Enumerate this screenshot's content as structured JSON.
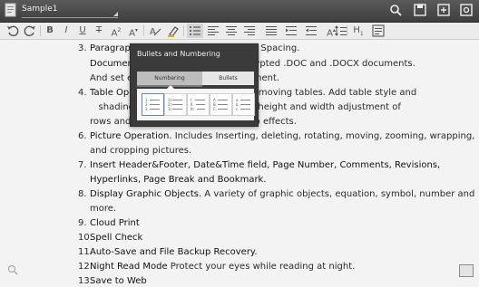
{
  "titlebar": {
    "doc_title": "Sample1",
    "icons": [
      "search-icon",
      "save-icon",
      "new-document-icon",
      "settings-icon"
    ]
  },
  "toolbar": {
    "tools": [
      "undo-icon",
      "redo-icon",
      "bold-icon",
      "italic-icon",
      "underline-icon",
      "strikethrough-icon",
      "font-size-icon",
      "font-color-icon",
      "clear-format-icon",
      "highlight-icon",
      "bullet-list-icon",
      "align-left-icon",
      "align-center-icon",
      "align-right-icon",
      "justify-icon",
      "indent-icon",
      "outdent-icon",
      "grow-font-icon",
      "line-spacing-icon",
      "heading-icon",
      "insert-icon"
    ],
    "labels": {
      "bold": "B",
      "italic": "I",
      "underline": "U",
      "strike": "T",
      "fontsize": "A",
      "fontcolor": "A",
      "heading": "H"
    }
  },
  "document": {
    "items": [
      {
        "num": "3.",
        "bold": "Paragrap",
        "rest": "                                    t and Spacing."
      },
      {
        "num": "",
        "bold": "Documen",
        "rest": "                                     ncrypted .DOC and .DOCX documents."
      },
      {
        "num": "",
        "bold": "",
        "rest": "And set e                                    ocument."
      },
      {
        "num": "4.",
        "bold": "Table Ope",
        "rest": "                                    and moving tables. Add table style and"
      },
      {
        "num": "",
        "bold": "",
        "rest": "   shading                                  ition, height and width adjustment of"
      },
      {
        "num": "",
        "bold": "",
        "rest": "rows and                                     wrap effects."
      },
      {
        "num": "6.",
        "bold": "Picture Operation.",
        "rest": " Includes Inserting, deleting, rotating, moving, zooming, wrapping,"
      },
      {
        "num": "",
        "bold": "",
        "rest": "and cropping pictures."
      },
      {
        "num": "7.",
        "bold": "Insert Header&Footer, Date&Time field, Page Number, Comments, Revisions,",
        "rest": ""
      },
      {
        "num": "",
        "bold": "Hyperlinks, Page Break and Bookmark.",
        "rest": ""
      },
      {
        "num": "8.",
        "bold": "Display Graphic Objects.",
        "rest": " A variety of graphic objects, equation, symbol, number and"
      },
      {
        "num": "",
        "bold": "",
        "rest": "more."
      },
      {
        "num": "9.",
        "bold": "Cloud Print",
        "rest": ""
      },
      {
        "num": "10.",
        "bold": "Spell Check",
        "rest": ""
      },
      {
        "num": "11.",
        "bold": "Auto-Save and File Backup Recovery.",
        "rest": ""
      },
      {
        "num": "12.",
        "bold": "Night Read Mode",
        "rest": " Protect your eyes while reading at night."
      },
      {
        "num": "13.",
        "bold": "Save to Web",
        "rest": ""
      }
    ]
  },
  "popup": {
    "title": "Bullets and Numbering",
    "tabs": [
      "Numbering",
      "Bullets"
    ],
    "selected_tab": "Numbering",
    "options_count_visible": 5
  }
}
